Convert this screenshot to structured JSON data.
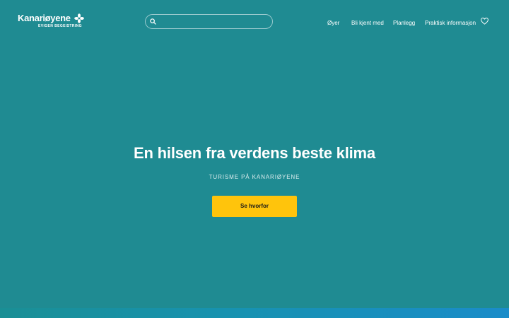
{
  "header": {
    "logo": {
      "name": "Kanariøyene",
      "tagline": "EVIGEN BEGEISTRING"
    },
    "search": {
      "value": "",
      "placeholder": ""
    },
    "nav": {
      "items": [
        {
          "label": "Øyer"
        },
        {
          "label": "Bli kjent med"
        },
        {
          "label": "Planlegg"
        },
        {
          "label": "Praktisk informasjon"
        }
      ]
    },
    "icons": {
      "search": "search-icon",
      "favorites": "heart-icon",
      "logo": "flower-icon"
    }
  },
  "hero": {
    "title": "En hilsen fra verdens beste klima",
    "subtitle": "TURISME PÅ KANARIØYENE",
    "cta_label": "Se hvorfor"
  },
  "colors": {
    "background": "#1f8b92",
    "accent": "#ffc40c",
    "text": "#ffffff"
  }
}
